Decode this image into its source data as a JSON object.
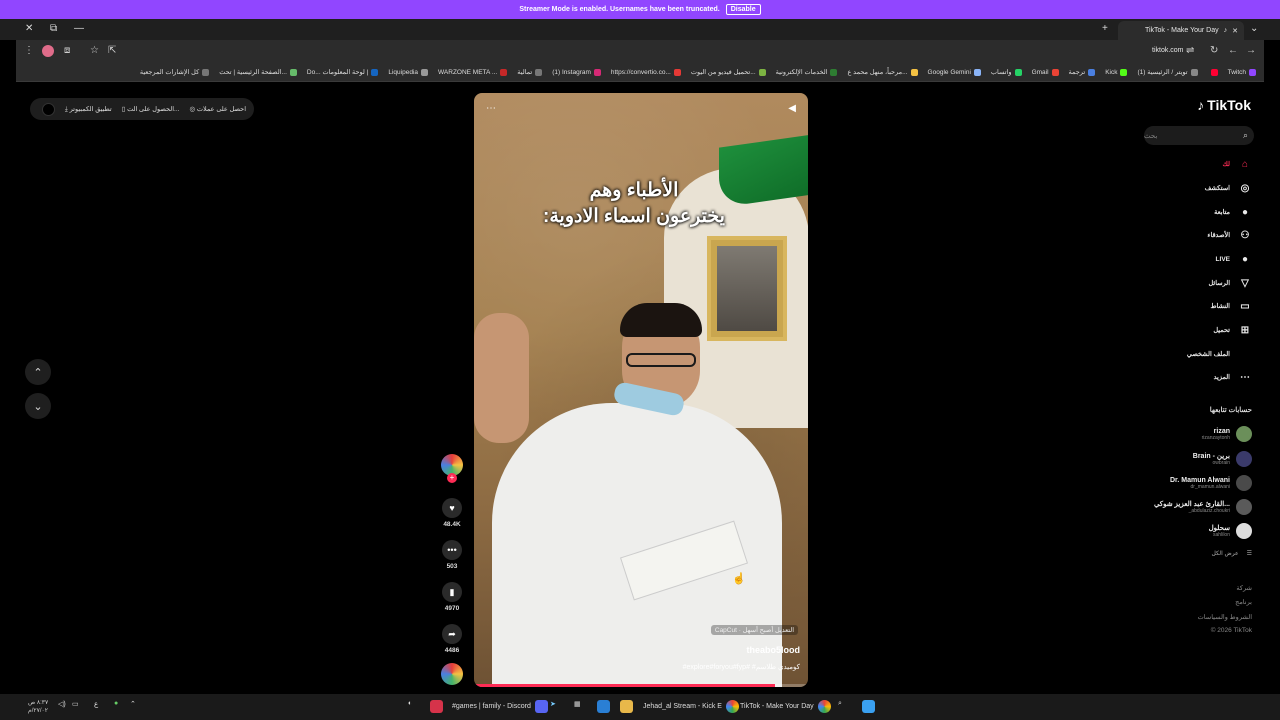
{
  "banner": {
    "text": "Streamer Mode is enabled. Usernames have been truncated.",
    "button": "Disable"
  },
  "browser": {
    "tab_title": "TikTok - Make Your Day",
    "url": "tiktok.com",
    "bookmarks": [
      {
        "label": "Twitch",
        "color": "#9146ff"
      },
      {
        "label": "",
        "color": "#ff0033"
      },
      {
        "label": "(1) تويتر / الرئيسية",
        "color": "#888888"
      },
      {
        "label": "Kick",
        "color": "#53fc18"
      },
      {
        "label": "ترجمة",
        "color": "#4a7fe0"
      },
      {
        "label": "Gmail",
        "color": "#ea4335"
      },
      {
        "label": "واتساب",
        "color": "#25d366"
      },
      {
        "label": "Google Gemini",
        "color": "#8ab4f8"
      },
      {
        "label": "مرحباً، منهل محمد ع...",
        "color": "#f5c243"
      },
      {
        "label": "الخدمات الإلكترونية",
        "color": "#2e7d32"
      },
      {
        "label": "تحميل فيديو من اليوت...",
        "color": "#7cb342"
      },
      {
        "label": "https://convertio.co...",
        "color": "#e53935"
      },
      {
        "label": "(1) Instagram",
        "color": "#d62976"
      },
      {
        "label": "تمالية",
        "color": "#777777"
      },
      {
        "label": "WARZONE META ...",
        "color": "#c62828"
      },
      {
        "label": "Liquipedia",
        "color": "#999999"
      },
      {
        "label": "Do... لوحة المعلومات |",
        "color": "#1565c0"
      },
      {
        "label": "الصفحة الرئيسية | تحث...",
        "color": "#66bb6a"
      },
      {
        "label": "كل الإشارات المرجعية",
        "color": "#777777"
      }
    ]
  },
  "page": {
    "pill": {
      "item1": "احصل على عملات",
      "item2": "الحصول على الت...",
      "item3": "تطبيق الكمبيوتر"
    },
    "video": {
      "caption_line1": "الأطباء وهم",
      "caption_line2": "يخترعون اسماء الادوية:",
      "capcut": "CapCut · التعديل أصبح أسهل",
      "author": "theabo5lood",
      "description": "#explore#foryou#fyp# #كوميدي طلاسم",
      "progress": 0.9
    },
    "actions": {
      "likes": "48.4K",
      "comments": "503",
      "saves": "4970",
      "shares": "4486"
    },
    "sidebar": {
      "logo": "TikTok",
      "search_placeholder": "بحث",
      "nav": [
        {
          "label": "لك",
          "icon": "⌂",
          "active": true
        },
        {
          "label": "استكشف",
          "icon": "◎",
          "active": false
        },
        {
          "label": "متابعة",
          "icon": "●",
          "active": false
        },
        {
          "label": "الأصدقاء",
          "icon": "⚇",
          "active": false
        },
        {
          "label": "LIVE",
          "icon": "●",
          "active": false
        },
        {
          "label": "الرسائل",
          "icon": "▽",
          "active": false
        },
        {
          "label": "النشاط",
          "icon": "▭",
          "active": false
        },
        {
          "label": "تحميل",
          "icon": "⊞",
          "active": false
        },
        {
          "label": "الملف الشخصي",
          "icon": "",
          "active": false
        },
        {
          "label": "المزيد",
          "icon": "⋯",
          "active": false
        }
      ],
      "following_header": "حسابات تتابعها",
      "accounts": [
        {
          "name": "rizan",
          "user": "rizanzaytonh",
          "color": "#6b8f5a"
        },
        {
          "name": "Brain - برين",
          "user": "owbrain",
          "color": "#3a3a6a"
        },
        {
          "name": "Dr. Mamun Alwani",
          "user": "dr_mamun.alwani",
          "color": "#4a4a4a"
        },
        {
          "name": "القارئ عبد العزيز شوكي...",
          "user": "_abdulaziz.choukri",
          "color": "#5a5a5a"
        },
        {
          "name": "سحلول",
          "user": "sahlilon",
          "color": "#dddddd"
        }
      ],
      "see_all": "عرض الكل",
      "footer": [
        "شركة",
        "برنامج",
        "الشروط والسياسات",
        "© 2026 TikTok"
      ]
    }
  },
  "taskbar": {
    "time": "٨:٣٧ ص",
    "date": "٢٧/٠٢/م",
    "items": [
      {
        "label": "#games | family - Discord",
        "color": "#5865f2"
      },
      {
        "label": "Jehad_al Stream - Kick E",
        "color": "#53fc18"
      },
      {
        "label": "TikTok - Make Your Day",
        "color": "#ea4335"
      }
    ]
  }
}
